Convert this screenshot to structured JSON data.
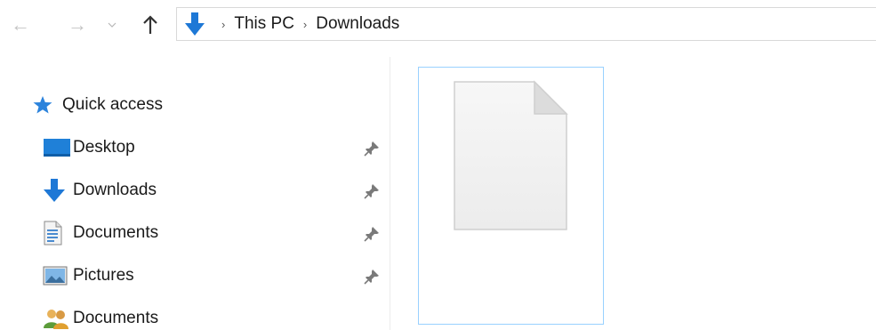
{
  "toolbar": {
    "back_icon": "arrow-left-icon",
    "forward_icon": "arrow-right-icon",
    "recent_icon": "chevron-down-icon",
    "up_icon": "arrow-up-icon"
  },
  "address": {
    "location_icon": "downloads-arrow-icon",
    "separator": "›",
    "crumbs": [
      "This PC",
      "Downloads"
    ]
  },
  "nav_pane": {
    "quick_access": {
      "label": "Quick access",
      "icon": "star-icon"
    },
    "items": [
      {
        "label": "Desktop",
        "icon": "desktop-icon",
        "pinned": true
      },
      {
        "label": "Downloads",
        "icon": "downloads-arrow-icon",
        "pinned": true
      },
      {
        "label": "Documents",
        "icon": "document-icon",
        "pinned": true
      },
      {
        "label": "Pictures",
        "icon": "pictures-icon",
        "pinned": true
      },
      {
        "label": "Documents",
        "icon": "shared-users-icon",
        "pinned": false
      }
    ]
  },
  "content": {
    "files": [
      {
        "icon": "blank-file-icon",
        "selected": true
      }
    ]
  },
  "colors": {
    "accent_blue": "#1e78d6",
    "selection_border": "#99d1ff",
    "disabled_arrow": "#c4c4c4"
  }
}
